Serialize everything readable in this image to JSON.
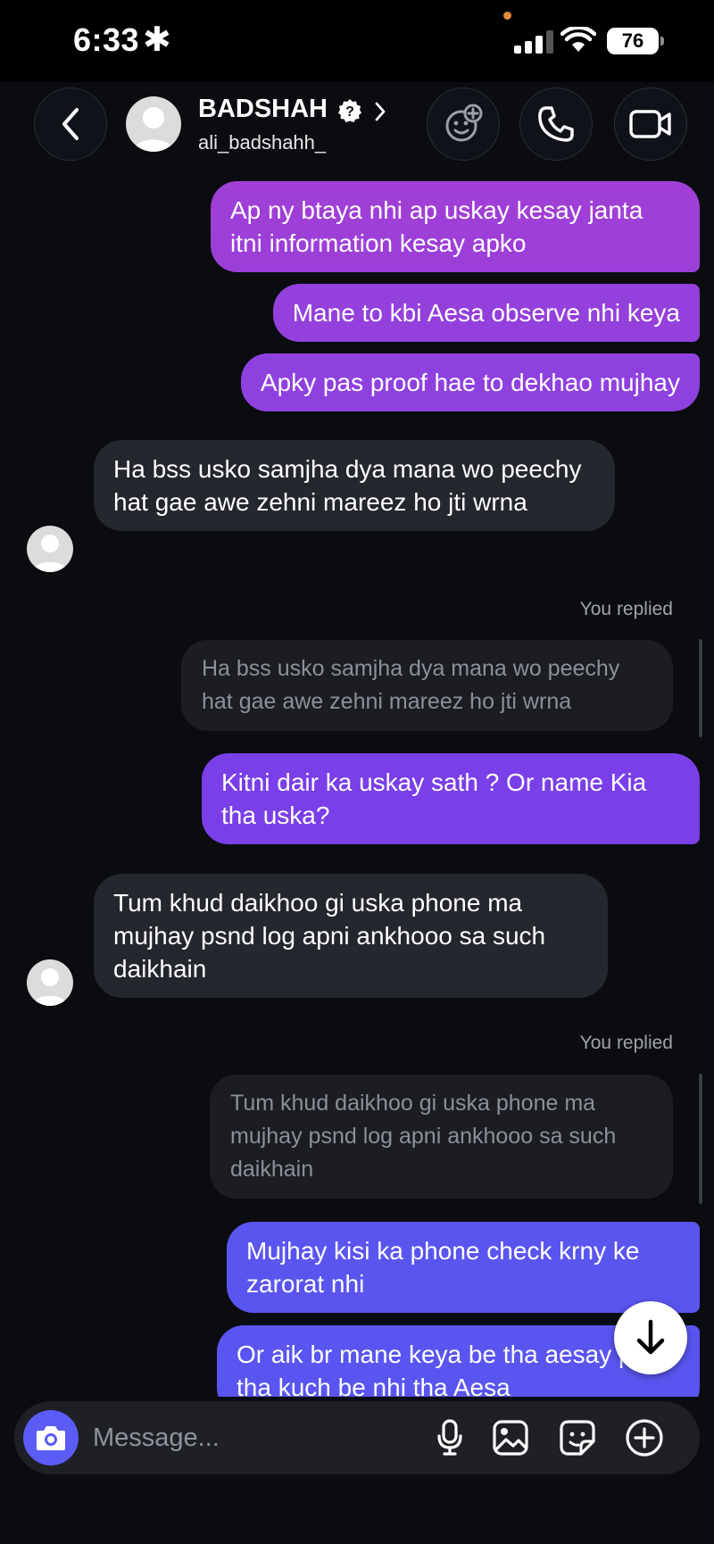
{
  "status_bar": {
    "time": "6:33",
    "time_icon": "asterisk-icon",
    "battery": "76"
  },
  "header": {
    "name": "BADSHAH",
    "handle": "ali_badshahh_",
    "icons": [
      "back-chevron-icon",
      "verified-badge-icon",
      "chevron-right-icon",
      "add-emoji-icon",
      "phone-icon",
      "video-camera-icon"
    ]
  },
  "colors": {
    "bubble_violet": "#a13fd6",
    "bubble_purple": "#7a3fe8",
    "bubble_indigo": "#5b55f0",
    "bubble_incoming": "#25272e",
    "background": "#0a0c10"
  },
  "messages": [
    {
      "dir": "out",
      "text": "Ap ny btaya nhi ap uskay kesay janta itni information kesay apko"
    },
    {
      "dir": "out",
      "text": "Mane to kbi Aesa observe nhi keya"
    },
    {
      "dir": "out",
      "text": "Apky pas proof hae to dekhao mujhay"
    },
    {
      "dir": "in",
      "text": "Ha bss usko samjha dya mana wo peechy hat gae awe zehni mareez ho jti wrna"
    },
    {
      "dir": "reply_meta",
      "text": "You replied"
    },
    {
      "dir": "quote",
      "text": "Ha bss usko samjha dya mana wo peechy hat gae awe zehni mareez ho jti wrna"
    },
    {
      "dir": "out",
      "text": "Kitni dair ka uskay sath ? Or name Kia tha uska?"
    },
    {
      "dir": "in",
      "text": "Tum khud daikhoo gi uska phone ma mujhay psnd log apni ankhooo sa such daikhain"
    },
    {
      "dir": "reply_meta",
      "text": "You replied"
    },
    {
      "dir": "quote",
      "text": "Tum khud daikhoo gi uska phone ma mujhay psnd log apni ankhooo sa such daikhain"
    },
    {
      "dir": "out",
      "text": "Mujhay kisi ka phone check krny ke zarorat nhi"
    },
    {
      "dir": "out",
      "text": "Or aik br mane keya be tha aesay pkra tha kuch be nhi tha Aesa"
    }
  ],
  "composer": {
    "placeholder": "Message...",
    "icons": [
      "camera-icon",
      "microphone-icon",
      "image-icon",
      "sticker-icon",
      "plus-circle-icon"
    ]
  },
  "scroll_button_icon": "arrow-down-icon"
}
